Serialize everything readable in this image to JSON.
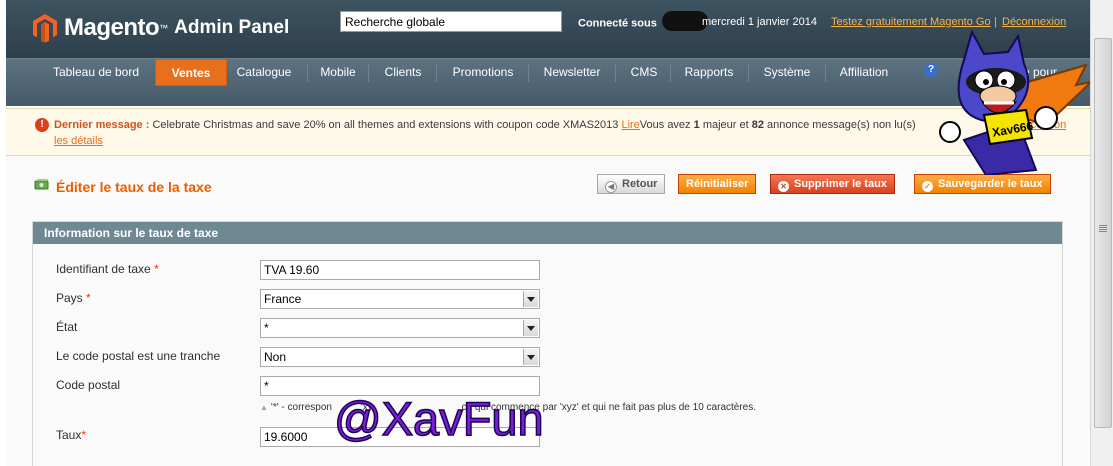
{
  "header": {
    "brand": "Magento",
    "tm": "™",
    "panel": "Admin Panel",
    "search_value": "Recherche globale",
    "connected_label": "Connecté sous",
    "date": "mercredi 1 janvier 2014",
    "try_link": "Testez gratuitement Magento Go",
    "separator": "|",
    "logout_link": "Déconnexion"
  },
  "nav": {
    "items": [
      "Tableau de bord",
      "Ventes",
      "Catalogue",
      "Mobile",
      "Clients",
      "Promotions",
      "Newsletter",
      "CMS",
      "Rapports",
      "Système",
      "Affiliation"
    ],
    "active": "Ventes",
    "help_icon": "?",
    "help_label": "l'aide pour"
  },
  "message": {
    "label": "Dernier message :",
    "text": "Celebrate Christmas and save 20% on all themes and extensions with coupon code XMAS2013",
    "read_link": "Lire",
    "count_prefix": "Vous avez",
    "major_count": "1",
    "major_text": "majeur et",
    "notice_count": "82",
    "notice_text": "annonce message(s) non lu(s)",
    "right_link": "réception",
    "details_link": "les détails"
  },
  "page": {
    "title": "Éditer le taux de la taxe",
    "buttons": {
      "back": "Retour",
      "reset": "Réinitialiser",
      "delete": "Supprimer le taux",
      "save": "Sauvegarder le taux"
    }
  },
  "section": {
    "title": "Information sur le taux de taxe",
    "fields": {
      "identifier_label": "Identifiant de taxe",
      "identifier_value": "TVA 19.60",
      "country_label": "Pays",
      "country_value": "France",
      "state_label": "État",
      "state_value": "*",
      "zip_range_label": "Le code postal est une tranche",
      "zip_range_value": "Non",
      "zip_label": "Code postal",
      "zip_value": "*",
      "zip_hint_start": "'*' - correspon",
      "zip_hint_mid": "'xy",
      "zip_hint_end": "ce qui commence par 'xyz' et qui ne fait pas plus de 10 caractères.",
      "rate_label": "Taux",
      "rate_value": "19.6000",
      "required_mark": "*"
    }
  },
  "overlay": {
    "mascot_badge": "Xav666",
    "watermark": "@XavFun"
  },
  "colors": {
    "accent": "#eb5e00",
    "header_bg": "#2e3f4b",
    "nav_active": "#e8701d",
    "section_head": "#6f8992",
    "watermark": "#7a1fd3"
  }
}
